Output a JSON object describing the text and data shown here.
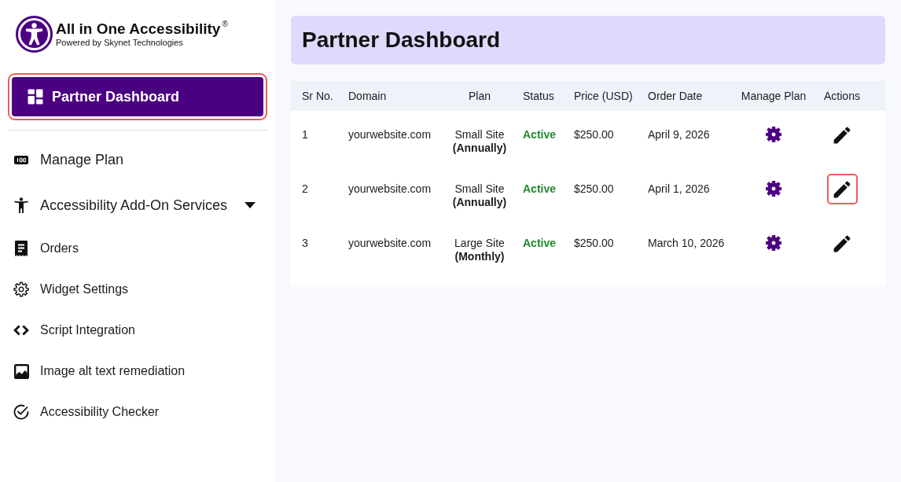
{
  "brand": {
    "title": "All in One Accessibility$^{®}$",
    "tagline": "Powered by Skynet Technologies"
  },
  "sidebar": {
    "items": [
      {
        "label": "Partner Dashboard",
        "selected": true,
        "focused": true,
        "submenu": false
      },
      {
        "label": "Manage Plan",
        "selected": false,
        "focused": false,
        "submenu": false
      },
      {
        "label": "Accessibility Add-On Services",
        "selected": false,
        "focused": false,
        "submenu": true
      },
      {
        "label": "Orders",
        "selected": false,
        "focused": false,
        "submenu": false
      },
      {
        "label": "Widget Settings",
        "selected": false,
        "focused": false,
        "submenu": false
      },
      {
        "label": "Script Integration",
        "selected": false,
        "focused": false,
        "submenu": false
      },
      {
        "label": "Image alt text remediation",
        "selected": false,
        "focused": false,
        "submenu": false
      },
      {
        "label": "Accessibility Checker",
        "selected": false,
        "focused": false,
        "submenu": false
      }
    ]
  },
  "page": {
    "title": "Partner Dashboard"
  },
  "table": {
    "columns": [
      "Sr No.",
      "Domain",
      "Plan",
      "Status",
      "Price (USD)",
      "Order Date",
      "Manage Plan",
      "Actions"
    ],
    "rows": [
      {
        "sr_no": "1",
        "domain": "yourwebsite.com",
        "plan": "Small Site",
        "billing": "(Annually)",
        "status": "Active",
        "price": "$250.00",
        "order_date": "April 9, 2026",
        "edit_focused": false
      },
      {
        "sr_no": "2",
        "domain": "yourwebsite.com",
        "plan": "Small Site",
        "billing": "(Annually)",
        "status": "Active",
        "price": "$250.00",
        "order_date": "April 1, 2026",
        "edit_focused": true
      },
      {
        "sr_no": "3",
        "domain": "yourwebsite.com",
        "plan": "Large Site",
        "billing": "(Monthly)",
        "status": "Active",
        "price": "$250.00",
        "order_date": "March 10, 2026",
        "edit_focused": false
      }
    ]
  }
}
